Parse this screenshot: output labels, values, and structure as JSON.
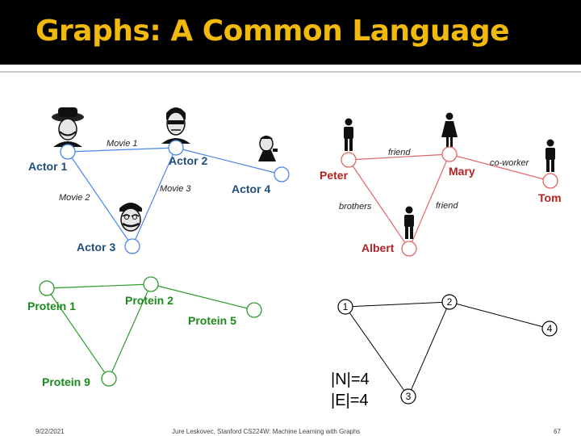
{
  "title": "Graphs: A Common Language",
  "footer": {
    "date": "9/22/2021",
    "author": "Jure Leskovec, Stanford CS224W: Machine Learning with Graphs",
    "page": "67"
  },
  "colors": {
    "title": "#F2B90D",
    "movie_graph": "#1F4E79",
    "movie_edges": "#4A86E8",
    "social_graph": "#B22222",
    "social_edges": "#E06666",
    "protein_graph": "#1B8A1B",
    "protein_edges": "#2E9B2E",
    "abstract_graph": "#000000"
  },
  "movie_graph": {
    "nodes": {
      "actor1": "Actor 1",
      "actor2": "Actor 2",
      "actor3": "Actor 3",
      "actor4": "Actor 4"
    },
    "edges": {
      "movie1": "Movie 1",
      "movie2": "Movie 2",
      "movie3": "Movie 3"
    }
  },
  "social_graph": {
    "nodes": {
      "peter": "Peter",
      "mary": "Mary",
      "tom": "Tom",
      "albert": "Albert"
    },
    "edges": {
      "friend1": "friend",
      "coworker": "co-worker",
      "brothers": "brothers",
      "friend2": "friend"
    }
  },
  "protein_graph": {
    "nodes": {
      "p1": "Protein 1",
      "p2": "Protein 2",
      "p5": "Protein 5",
      "p9": "Protein 9"
    }
  },
  "abstract_graph": {
    "nodes": {
      "n1": "1",
      "n2": "2",
      "n3": "3",
      "n4": "4"
    },
    "node_count": "|N|=4",
    "edge_count": "|E|=4"
  }
}
